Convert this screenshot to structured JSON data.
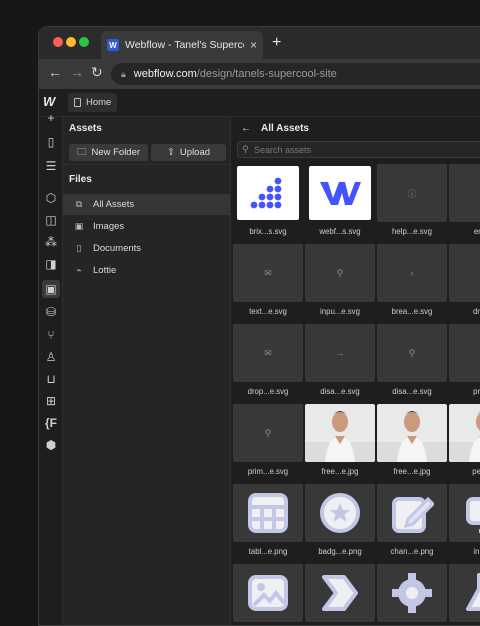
{
  "browser": {
    "tab_title": "Webflow - Tanel's Supercool S",
    "tab_close": "×",
    "new_tab": "+",
    "url_host": "webflow.com",
    "url_path": "/design/tanels-supercool-site",
    "back": "←",
    "forward": "→",
    "reload": "↻"
  },
  "designer": {
    "logo": "W",
    "breadcrumb": "Home"
  },
  "panel": {
    "header": "Assets",
    "new_folder": "New Folder",
    "upload": "Upload",
    "files_header": "Files",
    "items": [
      {
        "label": "All Assets",
        "icon": "all-assets-icon",
        "glyph": "⧉"
      },
      {
        "label": "Images",
        "icon": "images-icon",
        "glyph": "▣"
      },
      {
        "label": "Documents",
        "icon": "documents-icon",
        "glyph": "▯"
      },
      {
        "label": "Lottie",
        "icon": "lottie-icon",
        "glyph": "⌁"
      }
    ]
  },
  "main": {
    "title": "All Assets",
    "search_placeholder": "Search assets",
    "assets": [
      {
        "name": "brix...s.svg",
        "kind": "brix-logo"
      },
      {
        "name": "webf...s.svg",
        "kind": "webflow-logo"
      },
      {
        "name": "help...e.svg",
        "kind": "glyph",
        "glyph": "ⓘ"
      },
      {
        "name": "erro...",
        "kind": "plain"
      },
      {
        "name": "text...e.svg",
        "kind": "glyph",
        "glyph": "✉"
      },
      {
        "name": "inpu...e.svg",
        "kind": "glyph",
        "glyph": "⚲"
      },
      {
        "name": "brea...e.svg",
        "kind": "glyph",
        "glyph": "›"
      },
      {
        "name": "drop...",
        "kind": "plain"
      },
      {
        "name": "drop...e.svg",
        "kind": "glyph",
        "glyph": "✉"
      },
      {
        "name": "disa...e.svg",
        "kind": "glyph",
        "glyph": "→"
      },
      {
        "name": "disa...e.svg",
        "kind": "glyph",
        "glyph": "⚲"
      },
      {
        "name": "prim...",
        "kind": "plain"
      },
      {
        "name": "prim...e.svg",
        "kind": "glyph",
        "glyph": "⚲"
      },
      {
        "name": "free...e.jpg",
        "kind": "photo"
      },
      {
        "name": "free...e.jpg",
        "kind": "photo"
      },
      {
        "name": "pexe...",
        "kind": "photo"
      },
      {
        "name": "tabl...e.png",
        "kind": "table-icon"
      },
      {
        "name": "badg...e.png",
        "kind": "badge-icon"
      },
      {
        "name": "chan...e.png",
        "kind": "edit-icon"
      },
      {
        "name": "inpu...",
        "kind": "input-icon"
      },
      {
        "name": "",
        "kind": "image-icon"
      },
      {
        "name": "",
        "kind": "tag-icon"
      },
      {
        "name": "",
        "kind": "gear-icon"
      },
      {
        "name": "",
        "kind": "flask-icon"
      }
    ]
  },
  "colors": {
    "accent_blue": "#4353ff",
    "webflow_blue": "#2d5bd8"
  }
}
